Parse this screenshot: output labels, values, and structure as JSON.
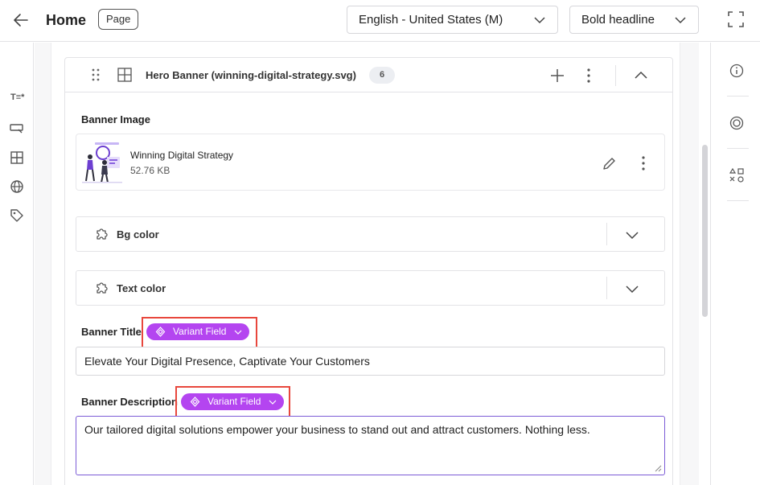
{
  "header": {
    "title": "Home",
    "page_badge": "Page",
    "language_select": "English - United States (M)",
    "variant_select": "Bold headline"
  },
  "left_rail": {
    "items": [
      "text-fields-icon",
      "input-icon",
      "layout-grid-icon",
      "globe-icon",
      "tag-icon"
    ]
  },
  "block": {
    "title": "Hero Banner (winning-digital-strategy.svg)",
    "count": "6"
  },
  "banner_image": {
    "label": "Banner Image",
    "asset_name": "Winning Digital Strategy",
    "asset_size": "52.76 KB"
  },
  "bg_color": {
    "label": "Bg color"
  },
  "text_color": {
    "label": "Text color"
  },
  "banner_title": {
    "label": "Banner Title",
    "variant_pill": "Variant Field",
    "value": "Elevate Your Digital Presence, Captivate Your Customers"
  },
  "banner_description": {
    "label": "Banner Description",
    "variant_pill": "Variant Field",
    "value": "Our tailored digital solutions empower your business to stand out and attract customers. Nothing less."
  },
  "right_rail": {
    "items": [
      "info-icon",
      "target-icon",
      "shapes-icon"
    ]
  },
  "colors": {
    "variant_pill": "#b445f0",
    "highlight_box": "#e8473d",
    "active_border": "#7c5cd6"
  }
}
